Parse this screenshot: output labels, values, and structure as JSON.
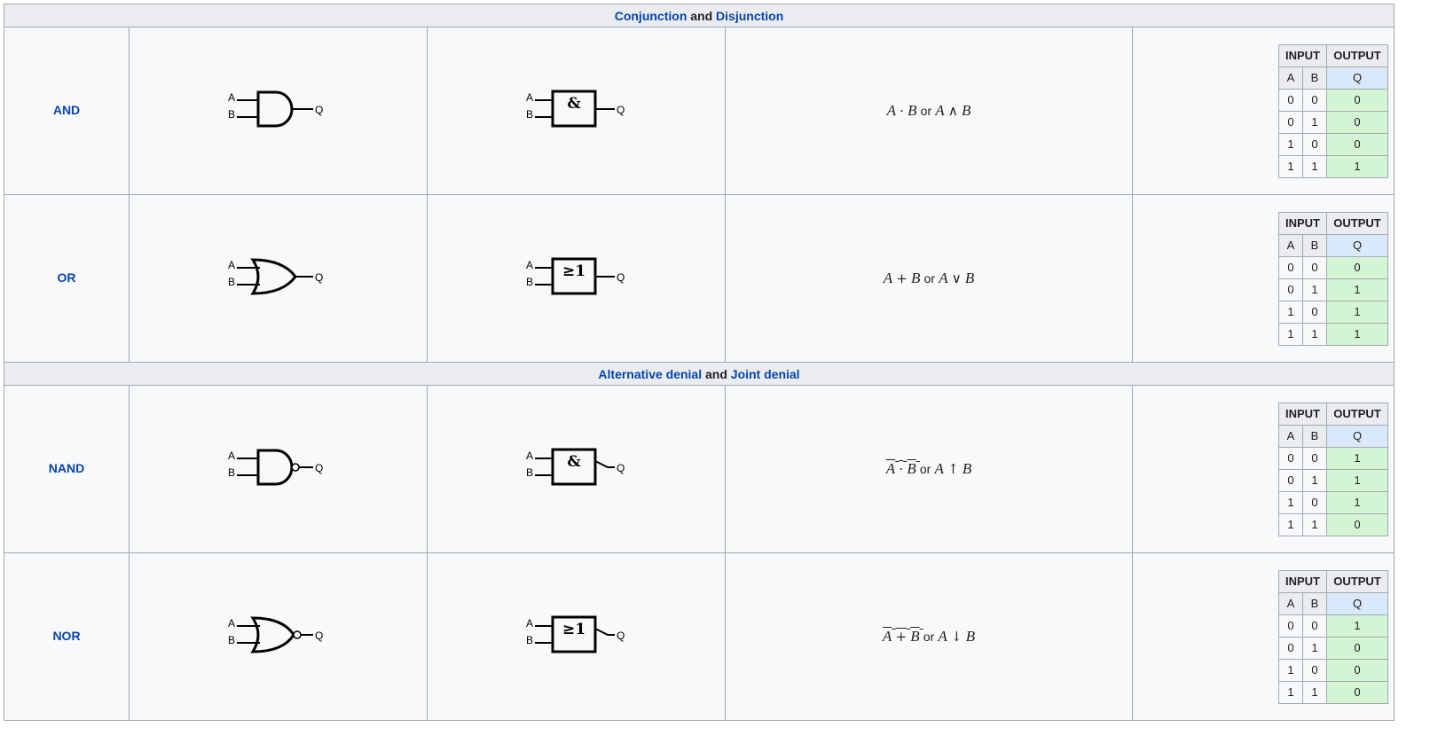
{
  "sections": [
    {
      "heading": {
        "link1": "Conjunction",
        "connector": " and ",
        "link2": "Disjunction"
      },
      "gates": [
        {
          "name": "AND",
          "ansi_icon": "and-gate-icon",
          "iec_symbol": "&",
          "expr": {
            "a": "A",
            "op1": "·",
            "b": "B",
            "or_word": "or",
            "a2": "A",
            "op2": "∧",
            "b2": "B"
          },
          "truth_table": {
            "input_header": "INPUT",
            "output_header": "OUTPUT",
            "cols": [
              "A",
              "B",
              "Q"
            ],
            "rows": [
              [
                "0",
                "0",
                "0"
              ],
              [
                "0",
                "1",
                "0"
              ],
              [
                "1",
                "0",
                "0"
              ],
              [
                "1",
                "1",
                "1"
              ]
            ]
          }
        },
        {
          "name": "OR",
          "ansi_icon": "or-gate-icon",
          "iec_symbol": "≥1",
          "expr": {
            "a": "A",
            "op1": "+",
            "b": "B",
            "or_word": "or",
            "a2": "A",
            "op2": "∨",
            "b2": "B"
          },
          "truth_table": {
            "input_header": "INPUT",
            "output_header": "OUTPUT",
            "cols": [
              "A",
              "B",
              "Q"
            ],
            "rows": [
              [
                "0",
                "0",
                "0"
              ],
              [
                "0",
                "1",
                "1"
              ],
              [
                "1",
                "0",
                "1"
              ],
              [
                "1",
                "1",
                "1"
              ]
            ]
          }
        }
      ]
    },
    {
      "heading": {
        "link1": "Alternative denial",
        "connector": " and ",
        "link2": "Joint denial"
      },
      "gates": [
        {
          "name": "NAND",
          "ansi_icon": "nand-gate-icon",
          "iec_symbol": "&",
          "expr": {
            "a": "A",
            "op1": "·",
            "b": "B",
            "or_word": "or",
            "a2": "A",
            "op2": "↑",
            "b2": "B"
          },
          "truth_table": {
            "input_header": "INPUT",
            "output_header": "OUTPUT",
            "cols": [
              "A",
              "B",
              "Q"
            ],
            "rows": [
              [
                "0",
                "0",
                "1"
              ],
              [
                "0",
                "1",
                "1"
              ],
              [
                "1",
                "0",
                "1"
              ],
              [
                "1",
                "1",
                "0"
              ]
            ]
          }
        },
        {
          "name": "NOR",
          "ansi_icon": "nor-gate-icon",
          "iec_symbol": "≥1",
          "expr": {
            "a": "A",
            "op1": "+",
            "b": "B",
            "or_word": "or",
            "a2": "A",
            "op2": "↓",
            "b2": "B"
          },
          "truth_table": {
            "input_header": "INPUT",
            "output_header": "OUTPUT",
            "cols": [
              "A",
              "B",
              "Q"
            ],
            "rows": [
              [
                "0",
                "0",
                "1"
              ],
              [
                "0",
                "1",
                "0"
              ],
              [
                "1",
                "0",
                "0"
              ],
              [
                "1",
                "1",
                "0"
              ]
            ]
          }
        }
      ]
    }
  ],
  "pin_labels": {
    "a": "A",
    "b": "B",
    "q": "Q"
  },
  "colors": {
    "link": "#0645ad",
    "header_bg": "#eaecf0",
    "output_header_bg": "#d9e8fb",
    "output_bg": "#d4f5d4",
    "border": "#a2a9b1"
  }
}
